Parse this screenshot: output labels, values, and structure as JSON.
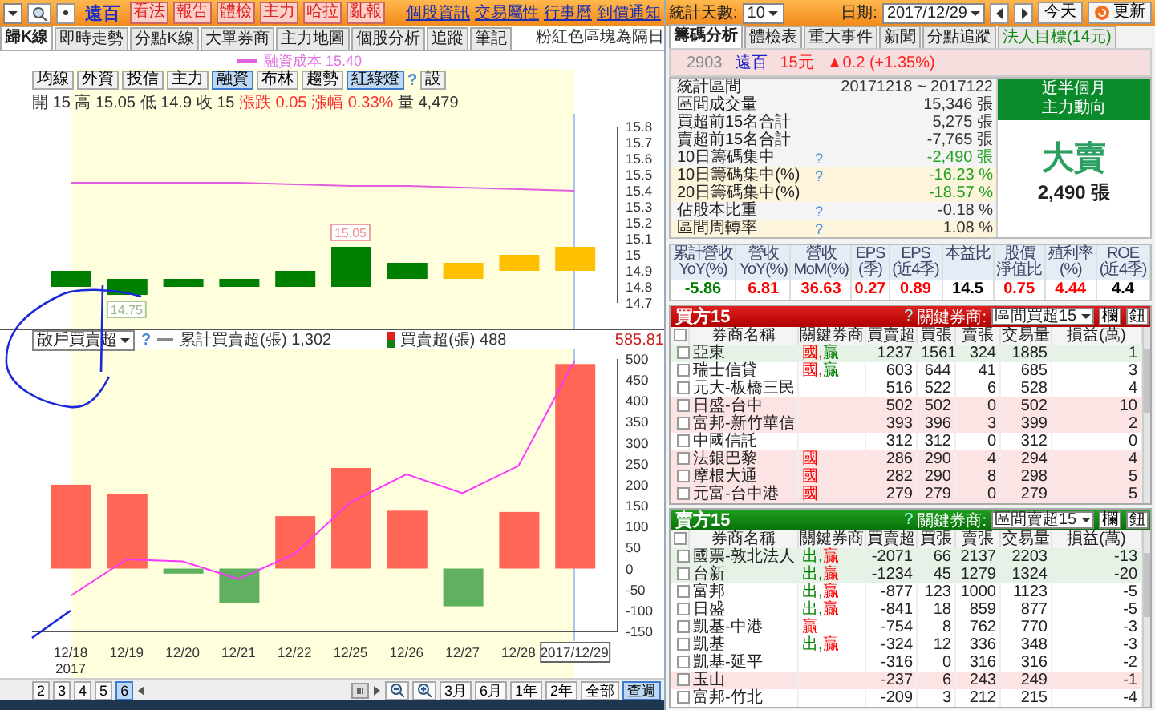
{
  "toolbar": {
    "stock_name": "遠百",
    "buttons": [
      "看法",
      "報告",
      "體檢",
      "主力",
      "哈拉",
      "亂報"
    ],
    "links": [
      "個股資訊",
      "交易屬性",
      "行事曆",
      "到價通知"
    ]
  },
  "chart_tabs": [
    {
      "label": "歸K線",
      "selected": true
    },
    {
      "label": "即時走勢",
      "selected": false
    },
    {
      "label": "分點K線",
      "selected": false
    },
    {
      "label": "大單券商",
      "selected": false
    },
    {
      "label": "主力地圖",
      "selected": false
    },
    {
      "label": "個股分析",
      "selected": false
    },
    {
      "label": "追蹤",
      "selected": false
    },
    {
      "label": "筆記",
      "selected": false
    }
  ],
  "chart_note": "粉紅色區塊為隔日",
  "indicator_buttons": [
    {
      "label": "均線",
      "selected": false
    },
    {
      "label": "外資",
      "selected": false
    },
    {
      "label": "投信",
      "selected": false
    },
    {
      "label": "主力",
      "selected": false
    },
    {
      "label": "融資",
      "selected": true
    },
    {
      "label": "布林",
      "selected": false
    },
    {
      "label": "趨勢",
      "selected": false
    },
    {
      "label": "紅綠燈",
      "selected": true
    }
  ],
  "indicator_help": "?",
  "indicator_settings": "設",
  "quote": [
    {
      "label": "開",
      "value": "15",
      "color": "#333333"
    },
    {
      "label": "高",
      "value": "15.05",
      "color": "#333333"
    },
    {
      "label": "低",
      "value": "14.9",
      "color": "#333333"
    },
    {
      "label": "收",
      "value": "15",
      "color": "#333333"
    },
    {
      "label": "漲跌",
      "value": "0.05",
      "color": "#ff3030"
    },
    {
      "label": "漲幅",
      "value": "0.33%",
      "color": "#ff3030"
    },
    {
      "label": "量",
      "value": "4,479",
      "color": "#333333"
    }
  ],
  "price_chart": {
    "cost_value": "15.40",
    "high_label": "15.05",
    "low_label": "14.75",
    "chart_data": {
      "type": "line",
      "series": [
        {
          "name": "融資成本",
          "color": "#e060e0",
          "values": [
            15.45,
            15.45,
            15.45,
            15.45,
            15.44,
            15.43,
            15.43,
            15.42,
            15.41,
            15.4
          ]
        }
      ],
      "ylim": [
        14.7,
        15.8
      ],
      "yticks": [
        15.8,
        15.7,
        15.6,
        15.5,
        15.4,
        15.3,
        15.2,
        15.1,
        {
          "value": 15.0,
          "label": "15"
        },
        14.9,
        14.8,
        14.7
      ]
    }
  },
  "flow_legend": {
    "selector": "散戶買賣超",
    "help": "?",
    "cumulative_value": "1,302",
    "net_value": "488",
    "cursor_value": "585.81"
  },
  "flow_chart": {
    "year_label": "2017",
    "chart_data": {
      "type": "bar",
      "categories": [
        "12/18",
        "12/19",
        "12/20",
        "12/21",
        "12/22",
        "12/25",
        "12/26",
        "12/27",
        "12/28",
        "2017/12/29"
      ],
      "series": [
        {
          "name": "買賣超(張)",
          "color": "#ff6655",
          "values": [
            200,
            178,
            null,
            null,
            125,
            240,
            138,
            null,
            135,
            488
          ]
        },
        {
          "color": "#5fb05f",
          "values": [
            null,
            null,
            -12,
            -82,
            null,
            null,
            null,
            -90,
            null,
            null
          ]
        },
        {
          "name": "累計買賣超(張)",
          "color": "#ff33ff",
          "type": "line",
          "values": [
            -65,
            22,
            17,
            -25,
            35,
            158,
            225,
            180,
            245,
            495
          ]
        }
      ],
      "ylim": [
        -150,
        500
      ],
      "yticks": [
        500,
        450,
        400,
        350,
        300,
        250,
        200,
        150,
        100,
        50,
        0,
        -50,
        -100,
        -150
      ]
    }
  },
  "range_pages": [
    {
      "label": "2",
      "selected": false
    },
    {
      "label": "3",
      "selected": false
    },
    {
      "label": "4",
      "selected": false
    },
    {
      "label": "5",
      "selected": false
    },
    {
      "label": "6",
      "selected": true
    }
  ],
  "range_buttons": [
    {
      "label": "3月",
      "selected": false
    },
    {
      "label": "6月",
      "selected": false
    },
    {
      "label": "1年",
      "selected": false
    },
    {
      "label": "2年",
      "selected": false
    },
    {
      "label": "全部",
      "selected": false
    },
    {
      "label": "查週",
      "selected": true
    }
  ],
  "controls": {
    "days_label": "統計天數:",
    "days": "10",
    "date_label": "日期:",
    "date": "2017/12/29",
    "today": "今天",
    "refresh": "更新"
  },
  "info_tabs": [
    {
      "label": "籌碼分析",
      "selected": true,
      "color": "#222222"
    },
    {
      "label": "體檢表",
      "selected": false,
      "color": "#222222"
    },
    {
      "label": "重大事件",
      "selected": false,
      "color": "#222222"
    },
    {
      "label": "新聞",
      "selected": false,
      "color": "#222222"
    },
    {
      "label": "分點追蹤",
      "selected": false,
      "color": "#222222"
    },
    {
      "label": "法人目標(14元)",
      "selected": false,
      "color": "#118811"
    }
  ],
  "stock_header": {
    "code": "2903",
    "name": "遠百",
    "price": "15元",
    "change": "▲0.2 (+1.35%)"
  },
  "stats": [
    {
      "label": "統計區間",
      "help": false,
      "value": "20171218 ~ 2017122",
      "color": "#333333",
      "shaded": false
    },
    {
      "label": "區間成交量",
      "help": false,
      "value": "15,346 張",
      "color": "#333333",
      "shaded": false
    },
    {
      "label": "買超前15名合計",
      "help": false,
      "value": "5,275 張",
      "color": "#333333",
      "shaded": false
    },
    {
      "label": "賣超前15名合計",
      "help": false,
      "value": "-7,765 張",
      "color": "#333333",
      "shaded": false
    },
    {
      "label": "10日籌碼集中",
      "help": true,
      "value": "-2,490 張",
      "color": "#22a022",
      "shaded": false
    },
    {
      "label": "10日籌碼集中(%)",
      "help": true,
      "value": "-16.23 %",
      "color": "#22a022",
      "shaded": true
    },
    {
      "label": "20日籌碼集中(%)",
      "help": false,
      "value": "-18.57 %",
      "color": "#22a022",
      "shaded": true
    },
    {
      "label": "佔股本比重",
      "help": true,
      "value": "-0.18 %",
      "color": "#333333",
      "shaded": false
    },
    {
      "label": "區間周轉率",
      "help": true,
      "value": "1.08 %",
      "color": "#333333",
      "shaded": true
    }
  ],
  "help_mark": "?",
  "trend_box": {
    "title": [
      "近半個月",
      "主力動向"
    ],
    "verdict": "大賣",
    "amount": "2,490 張"
  },
  "fundamentals": [
    {
      "title": "累計營收",
      "sub": "YoY(%)",
      "value": "-5.86",
      "color": "#008000"
    },
    {
      "title": "營收",
      "sub": "YoY(%)",
      "value": "6.81",
      "color": "#ff0000"
    },
    {
      "title": "營收",
      "sub": "MoM(%)",
      "value": "36.63",
      "color": "#ff0000"
    },
    {
      "title": "EPS",
      "sub": "(季)",
      "value": "0.27",
      "color": "#ff0000"
    },
    {
      "title": "EPS",
      "sub": "(近4季)",
      "value": "0.89",
      "color": "#ff0000"
    },
    {
      "title": "本益比",
      "value": "14.5",
      "color": "#000000"
    },
    {
      "title": "股價",
      "sub": "淨值比",
      "value": "0.75",
      "color": "#ff0000"
    },
    {
      "title": "殖利率",
      "sub": "(%)",
      "value": "4.44",
      "color": "#ff0000"
    },
    {
      "title": "ROE",
      "sub": "(近4季)",
      "value": "4.4",
      "color": "#000000"
    }
  ],
  "broker_tables": [
    {
      "kind": "buy",
      "title": "買方15",
      "help": "?",
      "filter_label": "關鍵券商:",
      "filter": "區間買超15",
      "buttons": [
        "欄",
        "鈕"
      ],
      "all_checked": false,
      "columns": [
        "券商名稱",
        "關鍵券商",
        "買賣超",
        "買張",
        "賣張",
        "交易量",
        "損益(萬)"
      ],
      "rows": [
        {
          "checked": false,
          "selected": true,
          "flagged": false,
          "tags": [
            {
              "text": "國,",
              "color": "#ff0000"
            },
            {
              "text": "贏",
              "color": "#008000"
            }
          ],
          "cells": [
            "亞東",
            "",
            "1237",
            "1561",
            "324",
            "1885",
            "1"
          ]
        },
        {
          "checked": false,
          "selected": false,
          "flagged": false,
          "tags": [
            {
              "text": "國,",
              "color": "#ff0000"
            },
            {
              "text": "贏",
              "color": "#008000"
            }
          ],
          "cells": [
            "瑞士信貸",
            "",
            "603",
            "644",
            "41",
            "685",
            "3"
          ]
        },
        {
          "checked": false,
          "selected": false,
          "flagged": false,
          "tags": [],
          "cells": [
            "元大-板橋三民",
            "",
            "516",
            "522",
            "6",
            "528",
            "4"
          ]
        },
        {
          "checked": false,
          "selected": false,
          "flagged": true,
          "tags": [],
          "cells": [
            "日盛-台中",
            "",
            "502",
            "502",
            "0",
            "502",
            "10"
          ]
        },
        {
          "checked": false,
          "selected": false,
          "flagged": true,
          "tags": [],
          "cells": [
            "富邦-新竹華信",
            "",
            "393",
            "396",
            "3",
            "399",
            "2"
          ]
        },
        {
          "checked": false,
          "selected": false,
          "flagged": false,
          "tags": [],
          "cells": [
            "中國信託",
            "",
            "312",
            "312",
            "0",
            "312",
            "0"
          ]
        },
        {
          "checked": false,
          "selected": false,
          "flagged": true,
          "tags": [
            {
              "text": "國",
              "color": "#ff0000"
            }
          ],
          "cells": [
            "法銀巴黎",
            "",
            "286",
            "290",
            "4",
            "294",
            "4"
          ]
        },
        {
          "checked": false,
          "selected": false,
          "flagged": true,
          "tags": [
            {
              "text": "國",
              "color": "#ff0000"
            }
          ],
          "cells": [
            "摩根大通",
            "",
            "282",
            "290",
            "8",
            "298",
            "5"
          ]
        },
        {
          "checked": false,
          "selected": false,
          "flagged": true,
          "tags": [
            {
              "text": "國",
              "color": "#ff0000"
            }
          ],
          "cells": [
            "元富-台中港",
            "",
            "279",
            "279",
            "0",
            "279",
            "5"
          ]
        }
      ]
    },
    {
      "kind": "sell",
      "title": "賣方15",
      "help": "?",
      "filter_label": "關鍵券商:",
      "filter": "區間賣超15",
      "buttons": [
        "欄",
        "鈕"
      ],
      "all_checked": false,
      "columns": [
        "券商名稱",
        "關鍵券商",
        "買賣超",
        "買張",
        "賣張",
        "交易量",
        "損益(萬)"
      ],
      "rows": [
        {
          "checked": false,
          "selected": true,
          "flagged": false,
          "tags": [
            {
              "text": "出,",
              "color": "#008000"
            },
            {
              "text": "贏",
              "color": "#ff0000"
            }
          ],
          "cells": [
            "國票-敦北法人",
            "",
            "-2071",
            "66",
            "2137",
            "2203",
            "-13"
          ]
        },
        {
          "checked": false,
          "selected": true,
          "flagged": false,
          "tags": [
            {
              "text": "出,",
              "color": "#008000"
            },
            {
              "text": "贏",
              "color": "#ff0000"
            }
          ],
          "cells": [
            "台新",
            "",
            "-1234",
            "45",
            "1279",
            "1324",
            "-20"
          ]
        },
        {
          "checked": false,
          "selected": false,
          "flagged": false,
          "tags": [
            {
              "text": "出,",
              "color": "#008000"
            },
            {
              "text": "贏",
              "color": "#ff0000"
            }
          ],
          "cells": [
            "富邦",
            "",
            "-877",
            "123",
            "1000",
            "1123",
            "-5"
          ]
        },
        {
          "checked": false,
          "selected": false,
          "flagged": false,
          "tags": [
            {
              "text": "出,",
              "color": "#008000"
            },
            {
              "text": "贏",
              "color": "#ff0000"
            }
          ],
          "cells": [
            "日盛",
            "",
            "-841",
            "18",
            "859",
            "877",
            "-5"
          ]
        },
        {
          "checked": false,
          "selected": false,
          "flagged": false,
          "tags": [
            {
              "text": "贏",
              "color": "#ff0000"
            }
          ],
          "cells": [
            "凱基-中港",
            "",
            "-754",
            "8",
            "762",
            "770",
            "-3"
          ]
        },
        {
          "checked": false,
          "selected": false,
          "flagged": false,
          "tags": [
            {
              "text": "出,",
              "color": "#008000"
            },
            {
              "text": "贏",
              "color": "#ff0000"
            }
          ],
          "cells": [
            "凱基",
            "",
            "-324",
            "12",
            "336",
            "348",
            "-3"
          ]
        },
        {
          "checked": false,
          "selected": false,
          "flagged": false,
          "tags": [],
          "cells": [
            "凱基-延平",
            "",
            "-316",
            "0",
            "316",
            "316",
            "-2"
          ]
        },
        {
          "checked": false,
          "selected": false,
          "flagged": true,
          "tags": [],
          "cells": [
            "玉山",
            "",
            "-237",
            "6",
            "243",
            "249",
            "-1"
          ]
        },
        {
          "checked": false,
          "selected": false,
          "flagged": false,
          "tags": [],
          "cells": [
            "富邦-竹北",
            "",
            "-209",
            "3",
            "212",
            "215",
            "-4"
          ]
        }
      ]
    }
  ]
}
